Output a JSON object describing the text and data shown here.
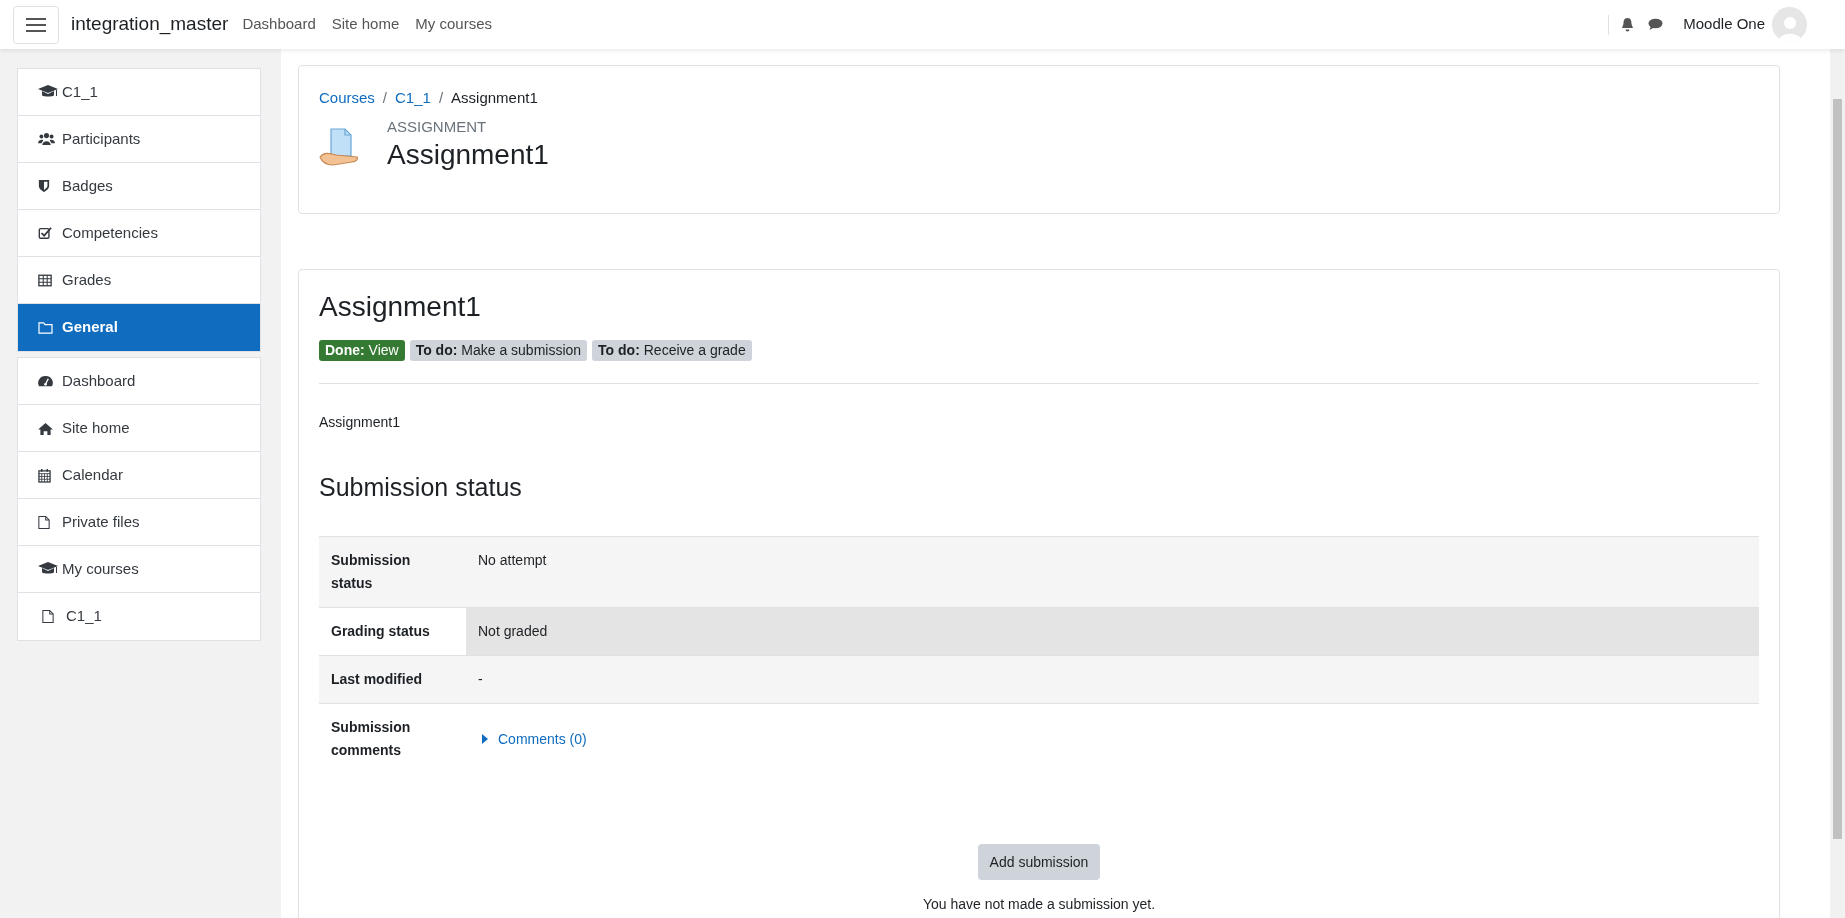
{
  "navbar": {
    "brand": "integration_master",
    "links": [
      "Dashboard",
      "Site home",
      "My courses"
    ],
    "user": "Moodle One"
  },
  "sidebar": {
    "groups": [
      {
        "items": [
          {
            "label": "C1_1",
            "selected": false
          },
          {
            "label": "Participants",
            "selected": false
          },
          {
            "label": "Badges",
            "selected": false
          },
          {
            "label": "Competencies",
            "selected": false
          },
          {
            "label": "Grades",
            "selected": false
          },
          {
            "label": "General",
            "selected": true
          }
        ]
      },
      {
        "items": [
          {
            "label": "Dashboard",
            "selected": false
          },
          {
            "label": "Site home",
            "selected": false
          },
          {
            "label": "Calendar",
            "selected": false
          },
          {
            "label": "Private files",
            "selected": false
          },
          {
            "label": "My courses",
            "selected": false,
            "children": [
              {
                "label": "C1_1",
                "selected": false
              }
            ]
          }
        ]
      }
    ]
  },
  "header": {
    "separator": "/",
    "breadcrumb": [
      {
        "label": "Courses",
        "link": true
      },
      {
        "label": "C1_1",
        "link": true
      },
      {
        "label": "Assignment1",
        "link": false
      }
    ],
    "module_type": "ASSIGNMENT",
    "title": "Assignment1"
  },
  "activity": {
    "title": "Assignment1",
    "completion": [
      {
        "kind": "done",
        "text": "**Done:** View"
      },
      {
        "kind": "todo",
        "text": "**To do:** Make a submission"
      },
      {
        "kind": "todo",
        "text": "**To do:** Receive a grade"
      }
    ],
    "description": "Assignment1"
  },
  "submission": {
    "heading": "Submission status",
    "rows": [
      {
        "label": "Submission status",
        "value": "No attempt",
        "kind": "text",
        "hovered": false
      },
      {
        "label": "Grading status",
        "value": "Not graded",
        "kind": "text",
        "hovered": true
      },
      {
        "label": "Last modified",
        "value": "-",
        "kind": "text",
        "hovered": false
      },
      {
        "label": "Submission comments",
        "value": "Comments (0)",
        "kind": "comments",
        "hovered": false
      }
    ],
    "button": "Add submission",
    "note": "You have not made a submission yet."
  }
}
